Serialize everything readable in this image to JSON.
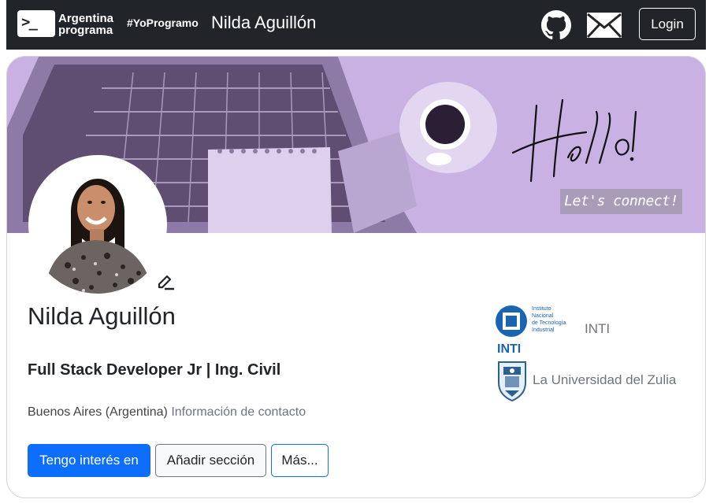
{
  "navbar": {
    "logo_glyph": ">_",
    "brand_line1": "Argentina",
    "brand_line2": "programa",
    "hashtag": "#YoProgramo",
    "title": "Nilda Aguillón",
    "github_icon": "github-icon",
    "mail_icon": "envelope-icon",
    "login_label": "Login"
  },
  "banner": {
    "handwritten": "Hello!",
    "tagline": "Let's connect!"
  },
  "profile": {
    "name": "Nilda Aguillón",
    "headline": "Full Stack Developer Jr | Ing. Civil",
    "location": "Buenos Aires (Argentina)",
    "contact_link": "Información de contacto",
    "edit_icon": "pencil-icon"
  },
  "actions": {
    "primary": "Tengo interés en",
    "add_section": "Añadir sección",
    "more": "Más..."
  },
  "education": [
    {
      "logo_text": [
        "Instituto",
        "Nacional",
        "de Tecnología",
        "Industrial"
      ],
      "logo_word": "INTI",
      "name": "INTI"
    },
    {
      "name": "La Universidad del Zulia"
    }
  ],
  "colors": {
    "navbar_bg": "#212529",
    "primary": "#0d6efd",
    "banner_purple": "#c9b2e3",
    "inti_blue": "#1b64b4"
  }
}
